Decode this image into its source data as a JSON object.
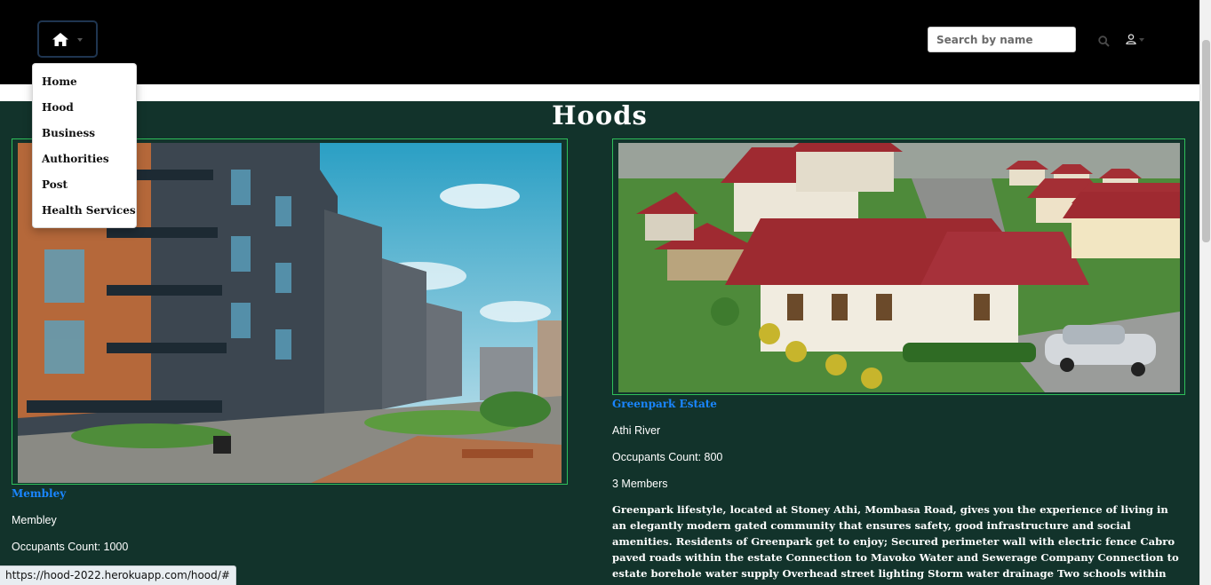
{
  "nav": {
    "search_placeholder": "Search by name",
    "menu": [
      {
        "label": "Home"
      },
      {
        "label": "Hood"
      },
      {
        "label": "Business"
      },
      {
        "label": "Authorities"
      },
      {
        "label": "Post"
      },
      {
        "label": "Health Services"
      }
    ]
  },
  "page": {
    "title": "Hoods"
  },
  "hoods": [
    {
      "name": "Membley",
      "location": "Membley",
      "occupants": "Occupants Count: 1000"
    },
    {
      "name": "Greenpark Estate",
      "location": "Athi River",
      "occupants": "Occupants Count: 800",
      "members": "3 Members",
      "description": "Greenpark lifestyle, located at Stoney Athi, Mombasa Road, gives you the experience of living in an elegantly modern gated community that ensures safety, good infrastructure and social amenities. Residents of Greenpark get to enjoy; Secured perimeter wall with electric fence Cabro paved roads within the estate Connection to Mavoko Water and Sewerage Company Connection to estate borehole water supply Overhead street lighting Storm water drainage Two schools within the estate mainly"
    }
  ],
  "status_bar": {
    "url": "https://hood-2022.herokuapp.com/hood/#"
  },
  "icons": {
    "home": "home-icon",
    "search": "search-icon",
    "user": "user-icon"
  },
  "colors": {
    "page_bg": "#12332b",
    "nav_bg": "#000000",
    "link": "#1a86ff",
    "card_border": "#2fbf5a"
  }
}
